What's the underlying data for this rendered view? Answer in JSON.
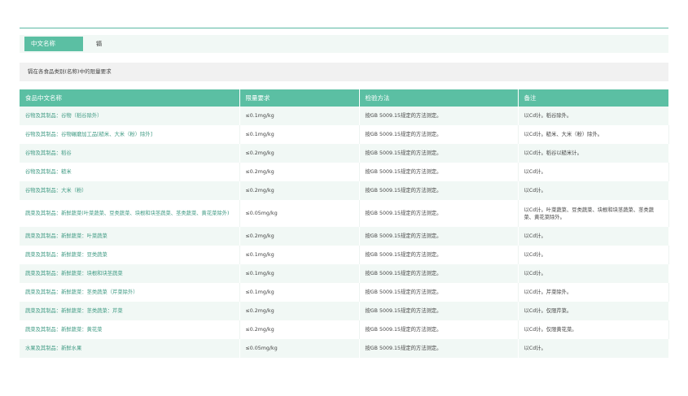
{
  "element_name": {
    "label": "中文名称",
    "value": "镉"
  },
  "requirement_title": "镉在各食品类别(名称)中的限量要求",
  "table": {
    "headers": [
      "食品中文名称",
      "限量要求",
      "检验方法",
      "备注"
    ],
    "rows": [
      [
        "谷物及其制品：谷物（稻谷除外）",
        "≤0.1mg/kg",
        "按GB 5009.15规定的方法测定。",
        "以Cd计。稻谷除外。"
      ],
      [
        "谷物及其制品：谷物碾磨加工品[糙米、大米（粉）除外]",
        "≤0.1mg/kg",
        "按GB 5009.15规定的方法测定。",
        "以Cd计。糙米、大米（粉）除外。"
      ],
      [
        "谷物及其制品：稻谷",
        "≤0.2mg/kg",
        "按GB 5009.15规定的方法测定。",
        "以Cd计。稻谷以糙米计。"
      ],
      [
        "谷物及其制品：糙米",
        "≤0.2mg/kg",
        "按GB 5009.15规定的方法测定。",
        "以Cd计。"
      ],
      [
        "谷物及其制品：大米（粉）",
        "≤0.2mg/kg",
        "按GB 5009.15规定的方法测定。",
        "以Cd计。"
      ],
      [
        "蔬菜及其制品：新鲜蔬菜(叶菜蔬菜、豆类蔬菜、块根和块茎蔬菜、茎类蔬菜、黄花菜除外)",
        "≤0.05mg/kg",
        "按GB 5009.15规定的方法测定。",
        "以Cd计。叶菜蔬菜、豆类蔬菜、块根和块茎蔬菜、茎类蔬菜、黄花菜除外。"
      ],
      [
        "蔬菜及其制品：新鲜蔬菜：叶菜蔬菜",
        "≤0.2mg/kg",
        "按GB 5009.15规定的方法测定。",
        "以Cd计。"
      ],
      [
        "蔬菜及其制品：新鲜蔬菜：豆类蔬菜",
        "≤0.1mg/kg",
        "按GB 5009.15规定的方法测定。",
        "以Cd计。"
      ],
      [
        "蔬菜及其制品：新鲜蔬菜：块根和块茎蔬菜",
        "≤0.1mg/kg",
        "按GB 5009.15规定的方法测定。",
        "以Cd计。"
      ],
      [
        "蔬菜及其制品：新鲜蔬菜：茎类蔬菜（芹菜除外）",
        "≤0.1mg/kg",
        "按GB 5009.15规定的方法测定。",
        "以Cd计。芹菜除外。"
      ],
      [
        "蔬菜及其制品：新鲜蔬菜：茎类蔬菜：芹菜",
        "≤0.2mg/kg",
        "按GB 5009.15规定的方法测定。",
        "以Cd计。仅限芹菜。"
      ],
      [
        "蔬菜及其制品：新鲜蔬菜：黄花菜",
        "≤0.2mg/kg",
        "按GB 5009.15规定的方法测定。",
        "以Cd计。仅限黄花菜。"
      ],
      [
        "水果及其制品：新鲜水果",
        "≤0.05mg/kg",
        "按GB 5009.15规定的方法测定。",
        "以Cd计。"
      ]
    ]
  },
  "colors": {
    "accent": "#5bbfa3",
    "row_tint": "#f1f8f5",
    "link_text": "#3f9a83",
    "bar_gray": "#f1f1f1"
  }
}
